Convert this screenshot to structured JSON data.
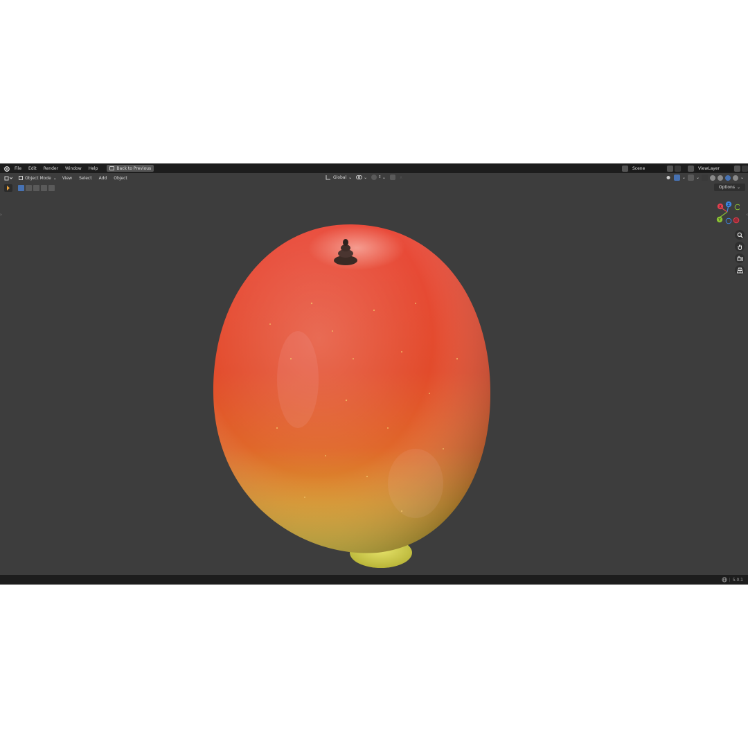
{
  "topbar": {
    "menus": [
      "File",
      "Edit",
      "Render",
      "Window",
      "Help"
    ],
    "back_button": "Back to Previous",
    "scene": "Scene",
    "view_layer": "ViewLayer"
  },
  "header": {
    "mode": "Object Mode",
    "menus": [
      "View",
      "Select",
      "Add",
      "Object"
    ],
    "transform_orientation": "Global",
    "options_label": "Options"
  },
  "gizmo": {
    "x_label": "X",
    "y_label": "Y",
    "z_label": "Z",
    "colors": {
      "x": "#e2404f",
      "y": "#8bc233",
      "z": "#3c84e0"
    }
  },
  "statusbar": {
    "version": "5.0.1"
  },
  "viewport": {
    "background": "#3d3d3d",
    "object": "mango"
  }
}
